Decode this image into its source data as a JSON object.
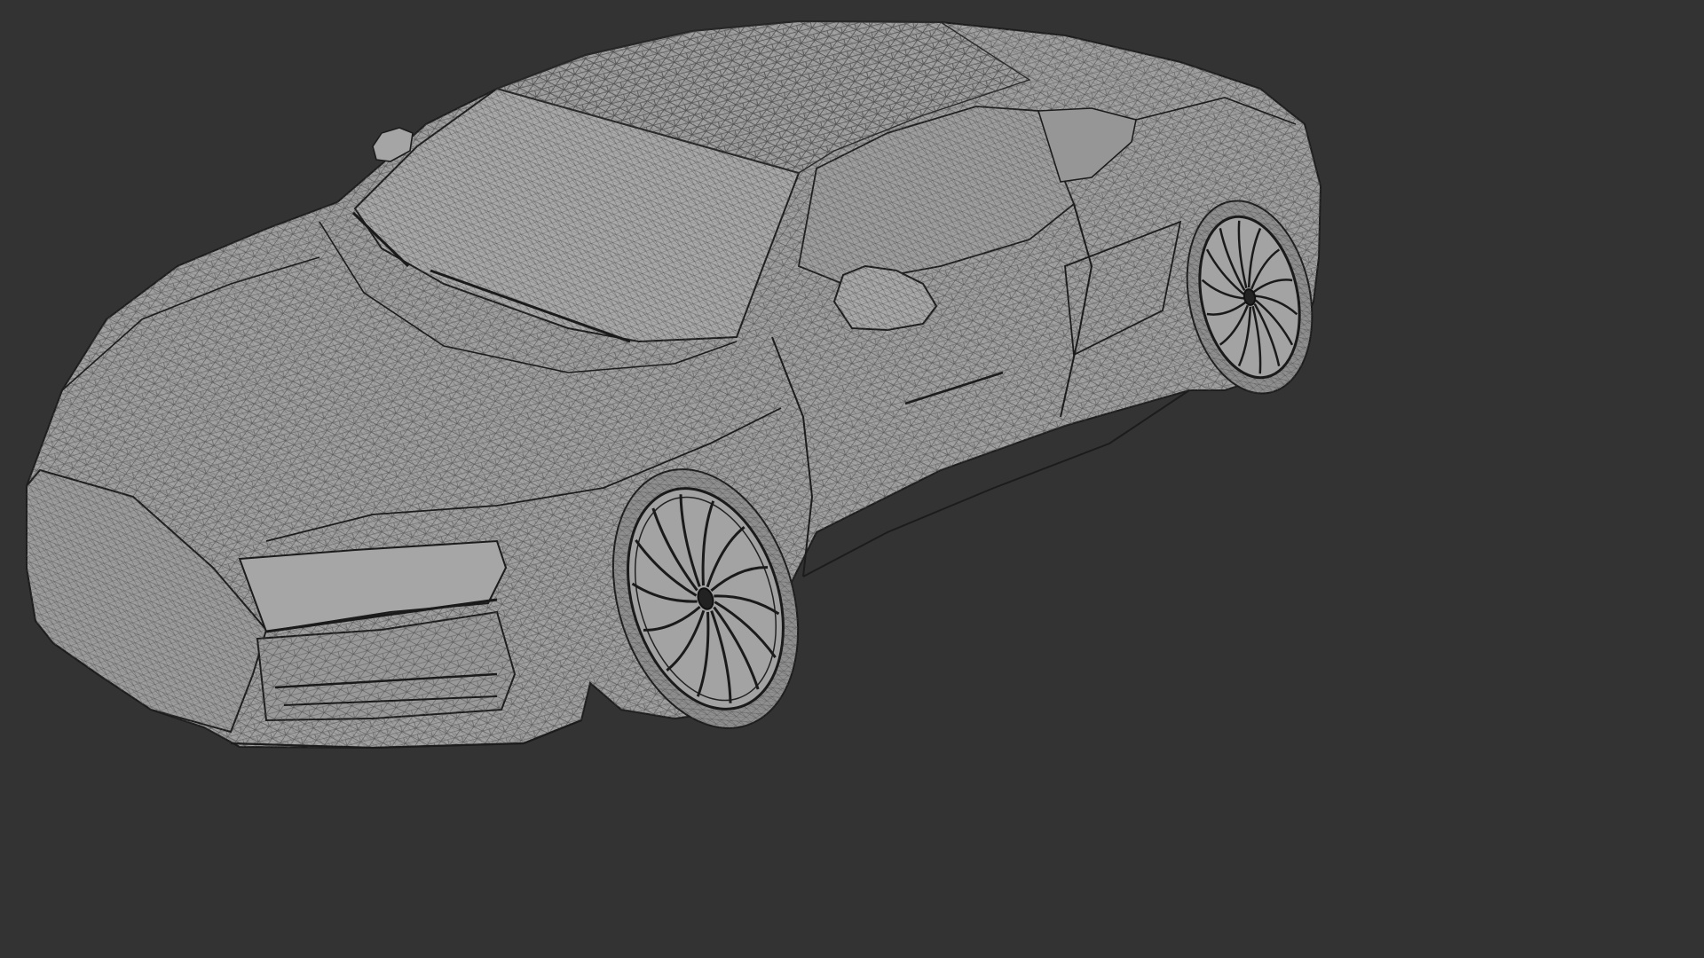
{
  "viewport": {
    "background": "#333333",
    "shading": "wireframe-on-shaded",
    "model": "sports-car",
    "colors": {
      "surface": "#a2a2a2",
      "surface_light": "#b1b1b1",
      "surface_dark": "#8c8c8c",
      "wire": "#4a4a4a",
      "edge": "#1c1c1c"
    }
  }
}
